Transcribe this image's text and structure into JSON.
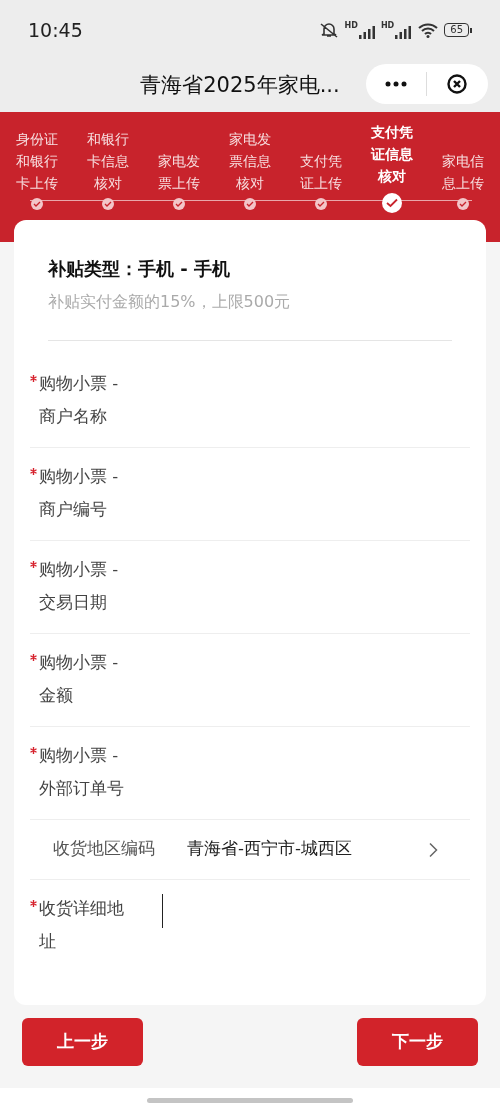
{
  "status_bar": {
    "time": "10:45",
    "signal_labels": [
      "HD",
      "HD"
    ],
    "battery": "65"
  },
  "title_bar": {
    "title": "青海省2025年家电..."
  },
  "steps": [
    {
      "label": "身份证和银行卡上传",
      "selected": false
    },
    {
      "label": "和银行卡信息核对",
      "selected": false
    },
    {
      "label": "家电发票上传",
      "selected": false
    },
    {
      "label": "家电发票信息核对",
      "selected": false
    },
    {
      "label": "支付凭证上传",
      "selected": false
    },
    {
      "label": "支付凭证信息核对",
      "selected": true
    },
    {
      "label": "家电信息上传",
      "selected": false
    }
  ],
  "subsidy": {
    "title": "补贴类型：手机 - 手机",
    "note": "补贴实付金额的15%，上限500元"
  },
  "fields": [
    {
      "kind": "text",
      "required": true,
      "label": "购物小票 - 商户名称"
    },
    {
      "kind": "text",
      "required": true,
      "label": "购物小票 - 商户编号"
    },
    {
      "kind": "text",
      "required": true,
      "label": "购物小票 - 交易日期"
    },
    {
      "kind": "text",
      "required": true,
      "label": "购物小票 - 金额"
    },
    {
      "kind": "text",
      "required": true,
      "label": "购物小票 - 外部订单号"
    },
    {
      "kind": "picker",
      "required": false,
      "label": "收货地区编码",
      "value": "青海省-西宁市-城西区"
    },
    {
      "kind": "textarea",
      "required": true,
      "label": "收货详细地址",
      "focused": true
    }
  ],
  "buttons": [
    {
      "label": "上一步"
    },
    {
      "label": "下一步"
    }
  ]
}
